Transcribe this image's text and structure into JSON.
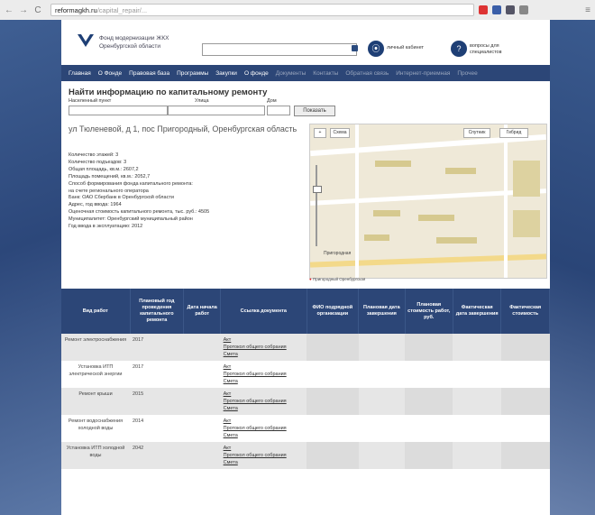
{
  "browser": {
    "url_domain": "reformagkh.ru",
    "url_path": "/capital_repair/...",
    "nav": [
      "←",
      "→",
      "C"
    ]
  },
  "header": {
    "org_line1": "Фонд модернизации ЖКХ",
    "org_line2": "Оренбургской области",
    "link1": "личный кабинет",
    "link2": "вопросы для специалистов"
  },
  "menu": [
    "Главная",
    "О Фонде",
    "Правовая база",
    "Программы",
    "Закупки",
    "О фонде",
    "Документы",
    "Контакты",
    "Обратная связь",
    "Интернет-приемная",
    "Прочее"
  ],
  "search_section": {
    "title": "Найти информацию по капитальному ремонту",
    "label_city": "Населенный пункт",
    "label_street": "Улица",
    "label_house": "Дом",
    "button": "Показать"
  },
  "address": "ул Тюленевой, д 1, пос Пригородный, Оренбургская область",
  "info": [
    "Количество этажей: 3",
    "Количество подъездов: 3",
    "Общая площадь, кв.м.: 2607,2",
    "Площадь помещений, кв.м.: 2052,7",
    "Способ формирования фонда капитального ремонта:",
    "на счете регионального оператора",
    "Банк: ОАО Сбербанк в Оренбургской области",
    "Адрес, год ввода: 1964",
    "Оценочная стоимость капитального ремонта, тыс. руб.: 4505",
    "Муниципалитет: Оренбургский муниципальный район",
    "Год ввода в эксплуатацию: 2012"
  ],
  "map": {
    "btn_plus": "+",
    "btn_layers": "Схема",
    "btn_map": "Спутник",
    "btn_fullscreen": "Гибрид",
    "street_label": "Пригородная",
    "footer": "Пригородный Оренбургская"
  },
  "table": {
    "headers": [
      "Вид работ",
      "Плановый год проведения капитального ремонта",
      "Дата начала работ",
      "Ссылка документа",
      "ФИО подрядной организации",
      "Плановая дата завершения",
      "Плановая стоимость работ, руб.",
      "Фактическая дата завершения",
      "Фактическая стоимость"
    ],
    "rows": [
      {
        "work": "Ремонт электроснабжения",
        "year": "2017",
        "docs": [
          "Акт",
          "Протокол общего собрания",
          "Смета"
        ]
      },
      {
        "work": "Установка ИТП электрической энергии",
        "year": "2017",
        "docs": [
          "Акт",
          "Протокол общего собрания",
          "Смета"
        ]
      },
      {
        "work": "Ремонт крыши",
        "year": "2015",
        "docs": [
          "Акт",
          "Протокол общего собрания",
          "Смета"
        ]
      },
      {
        "work": "Ремонт водоснабжения холодной воды",
        "year": "2014",
        "docs": [
          "Акт",
          "Протокол общего собрания",
          "Смета"
        ]
      },
      {
        "work": "Установка ИТП холодной воды",
        "year": "2042",
        "docs": [
          "Акт",
          "Протокол общего собрания",
          "Смета"
        ]
      }
    ]
  },
  "colors": {
    "accent": "#2c4677",
    "page_bg": "#ffffff"
  }
}
